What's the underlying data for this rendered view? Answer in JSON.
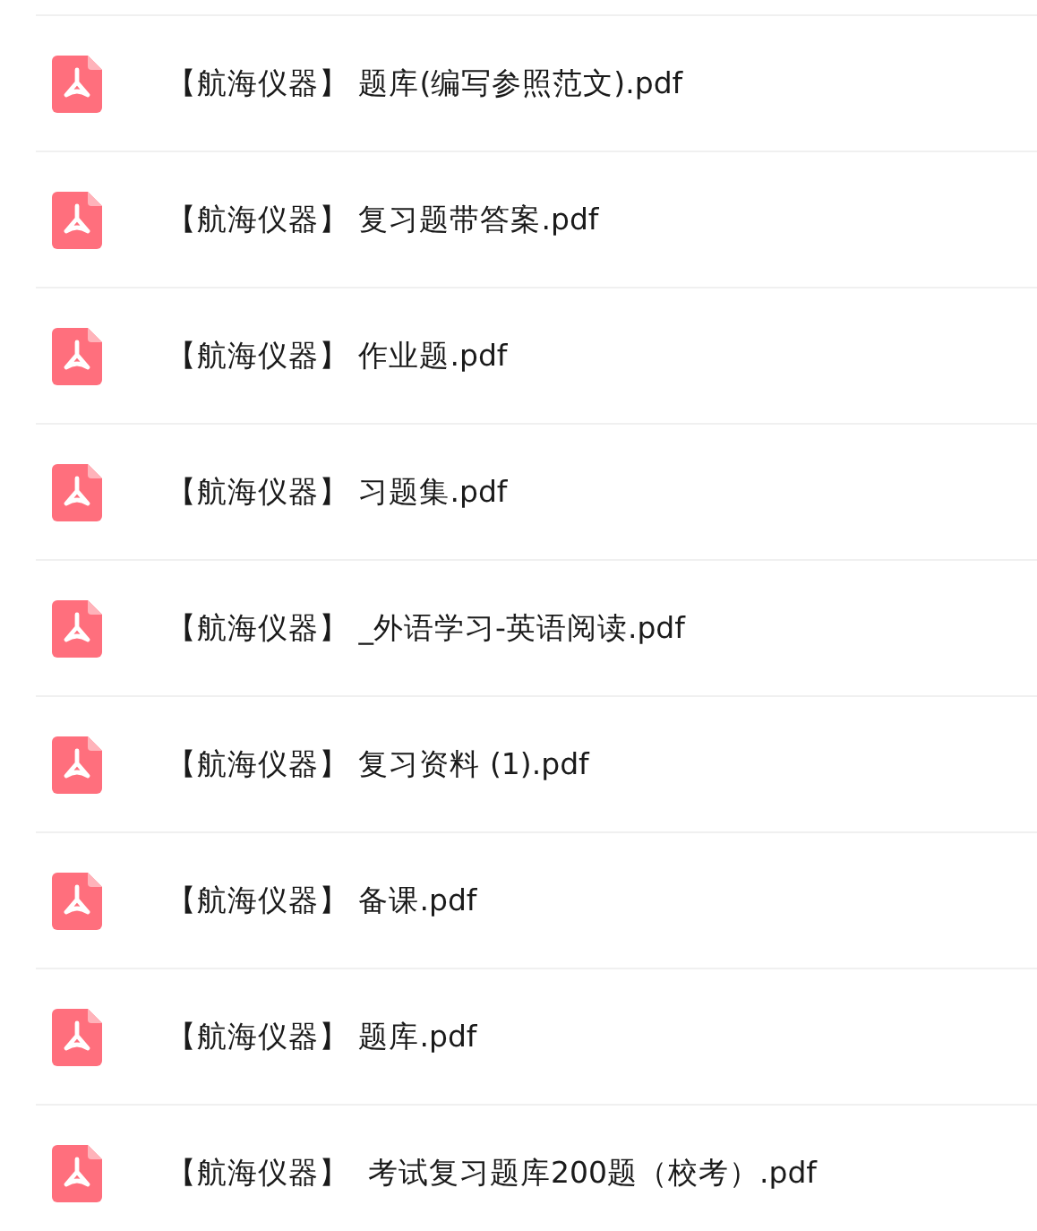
{
  "files": [
    {
      "name": "【航海仪器】 题库(编写参照范文).pdf"
    },
    {
      "name": "【航海仪器】 复习题带答案.pdf"
    },
    {
      "name": "【航海仪器】 作业题.pdf"
    },
    {
      "name": "【航海仪器】 习题集.pdf"
    },
    {
      "name": "【航海仪器】 _外语学习-英语阅读.pdf"
    },
    {
      "name": "【航海仪器】 复习资料 (1).pdf"
    },
    {
      "name": "【航海仪器】 备课.pdf"
    },
    {
      "name": "【航海仪器】 题库.pdf"
    },
    {
      "name": "【航海仪器】  考试复习题库200题（校考）.pdf"
    }
  ]
}
